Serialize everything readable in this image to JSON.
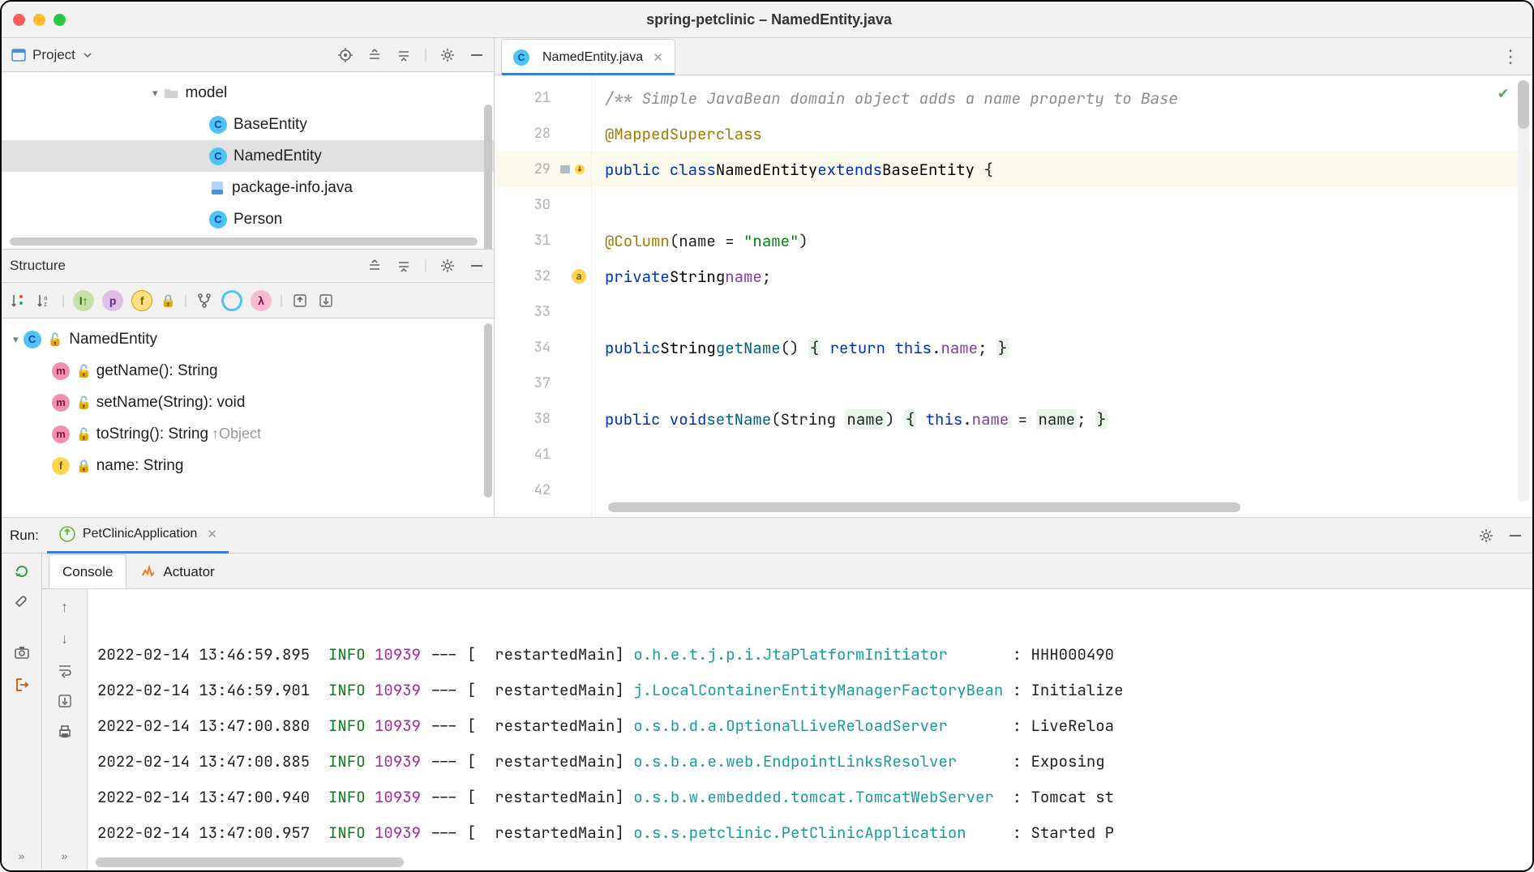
{
  "window": {
    "title": "spring-petclinic – NamedEntity.java"
  },
  "project": {
    "label": "Project",
    "folder": "model",
    "items": [
      {
        "icon": "c",
        "name": "BaseEntity"
      },
      {
        "icon": "c",
        "name": "NamedEntity",
        "selected": true
      },
      {
        "icon": "file",
        "name": "package-info.java"
      },
      {
        "icon": "c",
        "name": "Person"
      }
    ]
  },
  "structure": {
    "label": "Structure",
    "root": "NamedEntity",
    "members": [
      {
        "icon": "m",
        "sig": "getName(): String"
      },
      {
        "icon": "m",
        "sig": "setName(String): void"
      },
      {
        "icon": "m",
        "sig": "toString(): String",
        "inherit": "↑Object"
      },
      {
        "icon": "f",
        "sig": "name: String",
        "lock": true
      }
    ]
  },
  "editor": {
    "tab": "NamedEntity.java",
    "lines": [
      {
        "n": 21,
        "type": "comment",
        "text": "/** Simple JavaBean domain object adds a name property to <code>Base"
      },
      {
        "n": 28,
        "type": "anno",
        "text": "@MappedSuperclass"
      },
      {
        "n": 29,
        "type": "classdecl",
        "kw1": "public class",
        "name": "NamedEntity",
        "kw2": "extends",
        "base": "BaseEntity",
        "tail": " {",
        "hl": true,
        "gutter_icons": true
      },
      {
        "n": 30,
        "type": "blank"
      },
      {
        "n": 31,
        "type": "column",
        "indent": "    ",
        "anno": "@Column",
        "tail": "(name = ",
        "str": "\"name\"",
        "end": ")"
      },
      {
        "n": 32,
        "type": "field",
        "indent": "    ",
        "kw": "private",
        "typ": "String",
        "name": "name",
        "end": ";",
        "gutter_badge": "a"
      },
      {
        "n": 33,
        "type": "blank"
      },
      {
        "n": 34,
        "type": "getter",
        "indent": "    ",
        "kw": "public",
        "typ": "String",
        "fn": "getName",
        "body": "() { return this.name; }"
      },
      {
        "n": 37,
        "type": "blank"
      },
      {
        "n": 38,
        "type": "setter",
        "indent": "    ",
        "kw": "public void",
        "fn": "setName",
        "params": "(String name)",
        "body": " { this.name = name; }"
      },
      {
        "n": 41,
        "type": "blank"
      },
      {
        "n": 42,
        "type": "blank"
      }
    ]
  },
  "run": {
    "label": "Run:",
    "config": "PetClinicApplication",
    "tabs": {
      "console": "Console",
      "actuator": "Actuator"
    },
    "log": [
      {
        "ts": "2022-02-14 13:46:59.895",
        "lvl": "INFO",
        "pid": "10939",
        "sep": " --- [  restartedMain] ",
        "src": "o.h.e.t.j.p.i.JtaPlatformInitiator",
        "pad": "       ",
        "msg": ": HHH000490"
      },
      {
        "ts": "2022-02-14 13:46:59.901",
        "lvl": "INFO",
        "pid": "10939",
        "sep": " --- [  restartedMain] ",
        "src": "j.LocalContainerEntityManagerFactoryBean",
        "pad": " ",
        "msg": ": Initialize"
      },
      {
        "ts": "2022-02-14 13:47:00.880",
        "lvl": "INFO",
        "pid": "10939",
        "sep": " --- [  restartedMain] ",
        "src": "o.s.b.d.a.OptionalLiveReloadServer",
        "pad": "       ",
        "msg": ": LiveReloa"
      },
      {
        "ts": "2022-02-14 13:47:00.885",
        "lvl": "INFO",
        "pid": "10939",
        "sep": " --- [  restartedMain] ",
        "src": "o.s.b.a.e.web.EndpointLinksResolver",
        "pad": "      ",
        "msg": ": Exposing "
      },
      {
        "ts": "2022-02-14 13:47:00.940",
        "lvl": "INFO",
        "pid": "10939",
        "sep": " --- [  restartedMain] ",
        "src": "o.s.b.w.embedded.tomcat.TomcatWebServer",
        "pad": "  ",
        "msg": ": Tomcat st"
      },
      {
        "ts": "2022-02-14 13:47:00.957",
        "lvl": "INFO",
        "pid": "10939",
        "sep": " --- [  restartedMain] ",
        "src": "o.s.s.petclinic.PetClinicApplication",
        "pad": "     ",
        "msg": ": Started P"
      }
    ],
    "footer": {
      "left": "»",
      "inner": "»"
    }
  }
}
